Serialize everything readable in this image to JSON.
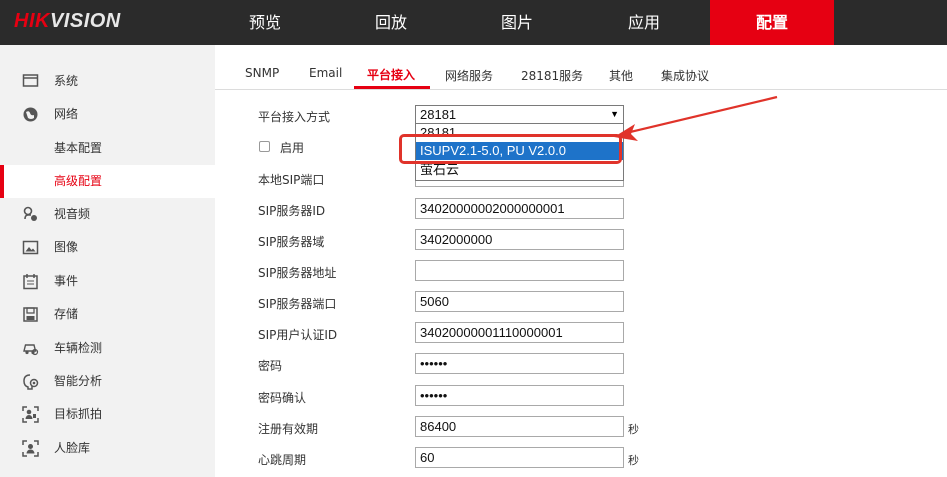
{
  "brand": {
    "part1": "HIK",
    "part2": "VISION",
    "accent": "#e60012"
  },
  "topnav": [
    {
      "label": "预览"
    },
    {
      "label": "回放"
    },
    {
      "label": "图片"
    },
    {
      "label": "应用"
    },
    {
      "label": "配置",
      "active": true
    }
  ],
  "sidebar": {
    "items": [
      {
        "label": "系统",
        "icon": "monitor-icon"
      },
      {
        "label": "网络",
        "icon": "globe-icon"
      },
      {
        "label": "基本配置",
        "sub": true
      },
      {
        "label": "高级配置",
        "sub": true,
        "active": true
      },
      {
        "label": "视音频",
        "icon": "audio-video-icon"
      },
      {
        "label": "图像",
        "icon": "image-icon"
      },
      {
        "label": "事件",
        "icon": "calendar-icon"
      },
      {
        "label": "存储",
        "icon": "storage-icon"
      },
      {
        "label": "车辆检测",
        "icon": "vehicle-detect-icon"
      },
      {
        "label": "智能分析",
        "icon": "smart-analysis-icon"
      },
      {
        "label": "目标抓拍",
        "icon": "target-capture-icon"
      },
      {
        "label": "人脸库",
        "icon": "face-library-icon"
      }
    ]
  },
  "tabs": [
    {
      "label": "SNMP"
    },
    {
      "label": "Email"
    },
    {
      "label": "平台接入",
      "active": true
    },
    {
      "label": "网络服务"
    },
    {
      "label": "28181服务"
    },
    {
      "label": "其他"
    },
    {
      "label": "集成协议"
    }
  ],
  "form": {
    "access_mode_label": "平台接入方式",
    "access_mode_value": "28181",
    "access_mode_options": [
      "28181",
      "ISUPV2.1-5.0, PU V2.0.0",
      "萤石云"
    ],
    "enable_label": "启用",
    "local_sip_port_label": "本地SIP端口",
    "sip_server_id_label": "SIP服务器ID",
    "sip_server_id_value": "34020000002000000001",
    "sip_server_domain_label": "SIP服务器域",
    "sip_server_domain_value": "3402000000",
    "sip_server_addr_label": "SIP服务器地址",
    "sip_server_addr_value": "",
    "sip_server_port_label": "SIP服务器端口",
    "sip_server_port_value": "5060",
    "sip_user_auth_id_label": "SIP用户认证ID",
    "sip_user_auth_id_value": "34020000001110000001",
    "password_label": "密码",
    "password_value": "••••••",
    "password_confirm_label": "密码确认",
    "password_confirm_value": "••••••",
    "register_validity_label": "注册有效期",
    "register_validity_value": "86400",
    "register_validity_unit": "秒",
    "heartbeat_label": "心跳周期",
    "heartbeat_value": "60",
    "heartbeat_unit": "秒"
  },
  "annotation": {
    "color": "#e0332a"
  }
}
